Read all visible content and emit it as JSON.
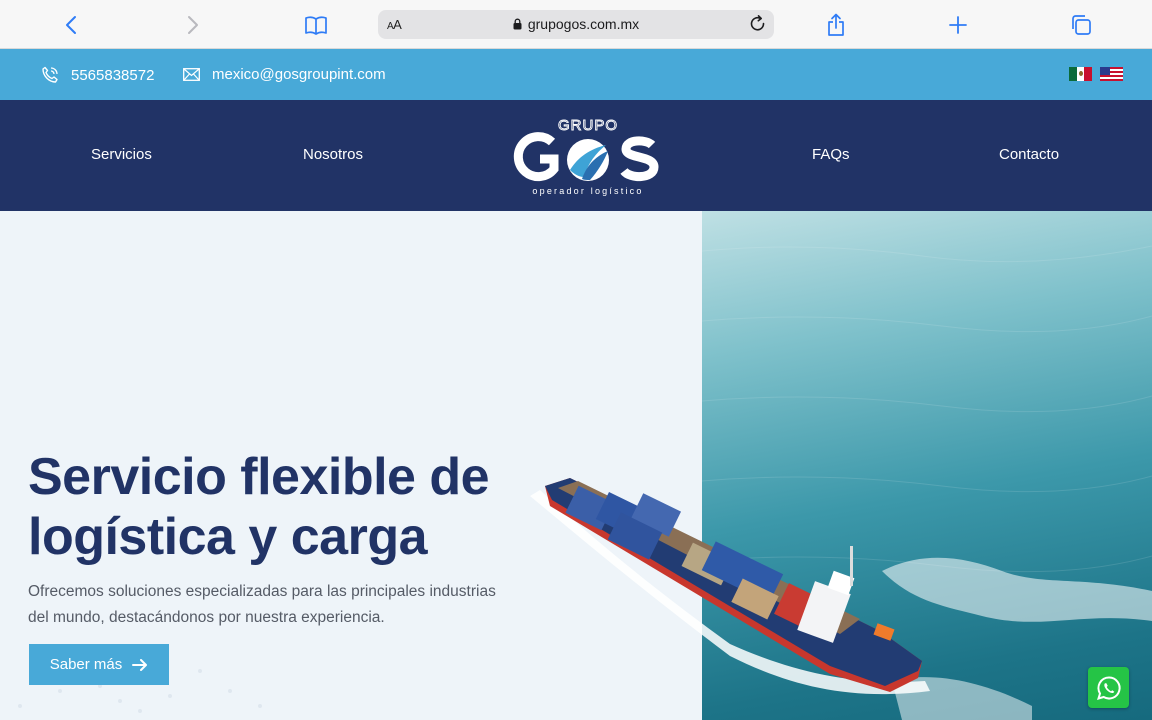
{
  "browser": {
    "url": "grupogos.com.mx",
    "aa_large": "A",
    "aa_small": "A"
  },
  "topbar": {
    "phone": "5565838572",
    "email": "mexico@gosgroupint.com",
    "flags": [
      "mexico-flag",
      "usa-flag"
    ]
  },
  "nav": {
    "items": [
      "Servicios",
      "Nosotros",
      "FAQs",
      "Contacto"
    ],
    "logo": {
      "top": "GRUPO",
      "main": "GOS",
      "tagline": "operador logístico"
    }
  },
  "hero": {
    "title_line1": "Servicio flexible de",
    "title_line2": "logística y carga",
    "subtitle": "Ofrecemos soluciones especializadas para las principales industrias del mundo, destacándonos por nuestra experiencia.",
    "cta": "Saber más"
  },
  "colors": {
    "topbar": "#48a9d8",
    "navbar": "#213366",
    "title": "#213366",
    "whatsapp": "#25c446"
  }
}
